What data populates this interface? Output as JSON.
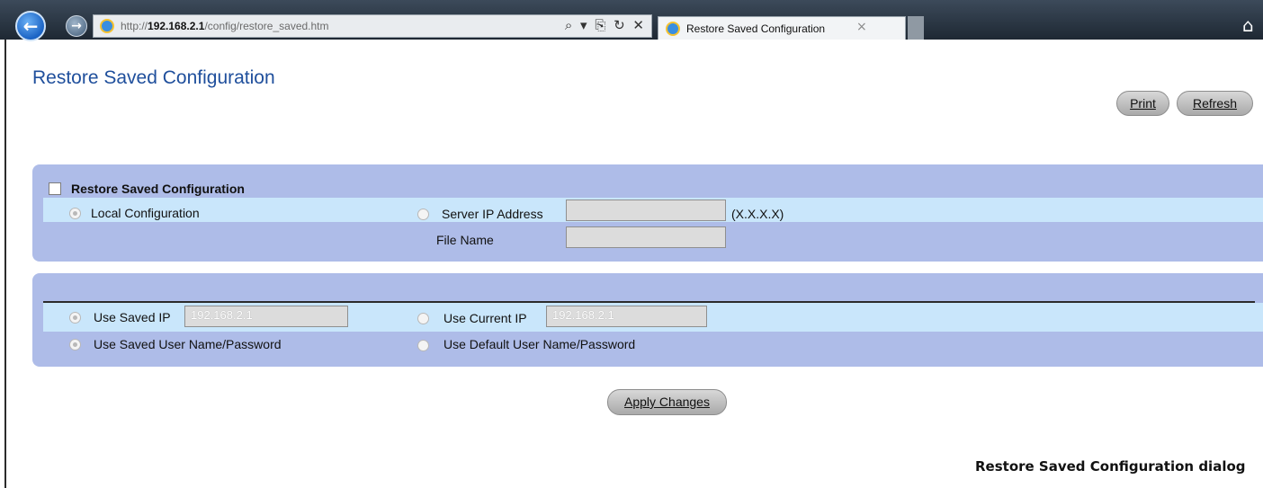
{
  "browser": {
    "url_prefix": "http://",
    "url_host": "192.168.2.1",
    "url_path": "/config/restore_saved.htm",
    "address_tools": "⌕ ▾ ⎘ ↻ ✕",
    "tab_title": "Restore Saved Configuration",
    "tab_close": "×",
    "back_icon": "←",
    "forward_icon": "→",
    "home_icon": "⌂"
  },
  "page": {
    "title": "Restore Saved Configuration",
    "print_label": "Print",
    "refresh_label": "Refresh"
  },
  "restore_panel": {
    "enable_label": "Restore Saved Configuration",
    "enable_checked": false,
    "local_config_label": "Local Configuration",
    "local_config_selected": true,
    "server_ip_label": "Server IP Address",
    "server_ip_value": "",
    "server_ip_hint": "(X.X.X.X)",
    "file_name_label": "File Name",
    "file_name_value": ""
  },
  "ip_panel": {
    "use_saved_ip_label": "Use Saved IP",
    "saved_ip_value": "192.168.2.1",
    "use_current_ip_label": "Use Current IP",
    "current_ip_value": "192.168.2.1",
    "use_saved_user_label": "Use Saved User Name/Password",
    "use_default_user_label": "Use Default User Name/Password"
  },
  "actions": {
    "apply_label": "Apply Changes"
  },
  "caption": "Restore Saved Configuration dialog"
}
